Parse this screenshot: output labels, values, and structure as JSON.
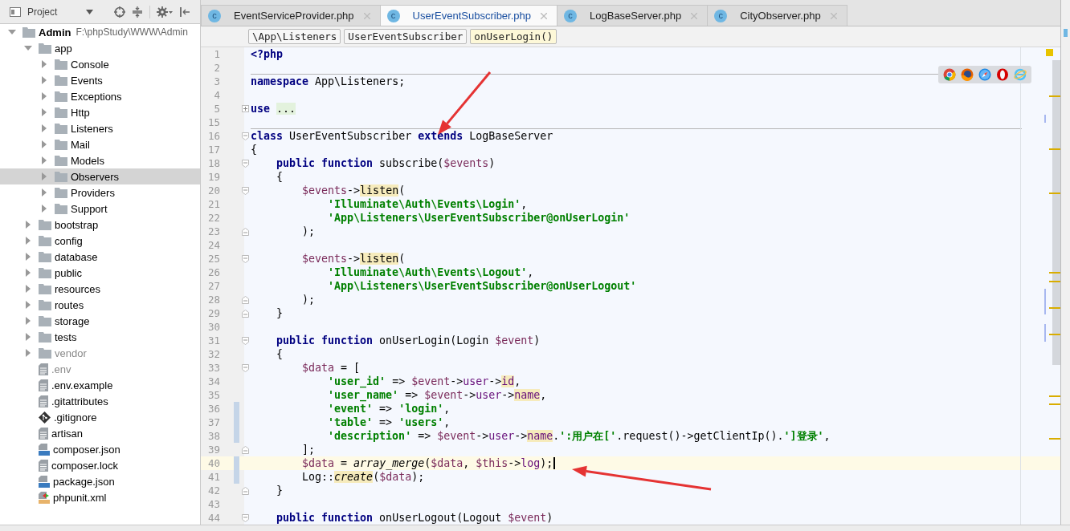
{
  "project_panel": {
    "title": "Project"
  },
  "tree": [
    {
      "name": "Admin",
      "path": "F:\\phpStudy\\WWW\\Admin",
      "kind": "folder",
      "expanded": true,
      "selected": false,
      "excluded": false,
      "children": [
        {
          "name": "app",
          "kind": "folder",
          "expanded": true,
          "selected": false,
          "excluded": false,
          "children": [
            {
              "name": "Console",
              "kind": "folder",
              "expanded": false,
              "selected": false,
              "excluded": false
            },
            {
              "name": "Events",
              "kind": "folder",
              "expanded": false,
              "selected": false,
              "excluded": false
            },
            {
              "name": "Exceptions",
              "kind": "folder",
              "expanded": false,
              "selected": false,
              "excluded": false
            },
            {
              "name": "Http",
              "kind": "folder",
              "expanded": false,
              "selected": false,
              "excluded": false
            },
            {
              "name": "Listeners",
              "kind": "folder",
              "expanded": false,
              "selected": false,
              "excluded": false
            },
            {
              "name": "Mail",
              "kind": "folder",
              "expanded": false,
              "selected": false,
              "excluded": false
            },
            {
              "name": "Models",
              "kind": "folder",
              "expanded": false,
              "selected": false,
              "excluded": false
            },
            {
              "name": "Observers",
              "kind": "folder",
              "expanded": false,
              "selected": true,
              "excluded": false
            },
            {
              "name": "Providers",
              "kind": "folder",
              "expanded": false,
              "selected": false,
              "excluded": false
            },
            {
              "name": "Support",
              "kind": "folder",
              "expanded": false,
              "selected": false,
              "excluded": false
            }
          ]
        },
        {
          "name": "bootstrap",
          "kind": "folder",
          "expanded": false,
          "selected": false,
          "excluded": false
        },
        {
          "name": "config",
          "kind": "folder",
          "expanded": false,
          "selected": false,
          "excluded": false
        },
        {
          "name": "database",
          "kind": "folder",
          "expanded": false,
          "selected": false,
          "excluded": false
        },
        {
          "name": "public",
          "kind": "folder",
          "expanded": false,
          "selected": false,
          "excluded": false
        },
        {
          "name": "resources",
          "kind": "folder",
          "expanded": false,
          "selected": false,
          "excluded": false
        },
        {
          "name": "routes",
          "kind": "folder",
          "expanded": false,
          "selected": false,
          "excluded": false
        },
        {
          "name": "storage",
          "kind": "folder",
          "expanded": false,
          "selected": false,
          "excluded": false
        },
        {
          "name": "tests",
          "kind": "folder",
          "expanded": false,
          "selected": false,
          "excluded": false
        },
        {
          "name": "vendor",
          "kind": "folder",
          "expanded": false,
          "selected": false,
          "excluded": true
        },
        {
          "name": ".env",
          "kind": "file",
          "selected": false,
          "excluded": true
        },
        {
          "name": ".env.example",
          "kind": "file",
          "selected": false,
          "excluded": false
        },
        {
          "name": ".gitattributes",
          "kind": "file",
          "selected": false,
          "excluded": false
        },
        {
          "name": ".gitignore",
          "kind": "git",
          "selected": false,
          "excluded": false
        },
        {
          "name": "artisan",
          "kind": "file",
          "selected": false,
          "excluded": false
        },
        {
          "name": "composer.json",
          "kind": "json",
          "selected": false,
          "excluded": false
        },
        {
          "name": "composer.lock",
          "kind": "file",
          "selected": false,
          "excluded": false
        },
        {
          "name": "package.json",
          "kind": "json",
          "selected": false,
          "excluded": false
        },
        {
          "name": "phpunit.xml",
          "kind": "xml",
          "selected": false,
          "excluded": false
        }
      ]
    }
  ],
  "tabs": [
    {
      "badge": "c",
      "label": "EventServiceProvider.php",
      "selected": false
    },
    {
      "badge": "c",
      "label": "UserEventSubscriber.php",
      "selected": true
    },
    {
      "badge": "c",
      "label": "LogBaseServer.php",
      "selected": false
    },
    {
      "badge": "c",
      "label": "CityObserver.php",
      "selected": false
    }
  ],
  "breadcrumbs": [
    {
      "label": "\\App\\Listeners",
      "selected": false
    },
    {
      "label": "UserEventSubscriber",
      "selected": false
    },
    {
      "label": "onUserLogin()",
      "selected": true
    }
  ],
  "code": [
    {
      "number": "1",
      "current": false,
      "changed": false,
      "separator": false,
      "tokens": [
        {
          "t": "<?php",
          "kind": "kw"
        }
      ]
    },
    {
      "number": "2",
      "current": false,
      "changed": false,
      "separator": true
    },
    {
      "number": "3",
      "current": false,
      "changed": false,
      "separator": false,
      "tokens": [
        {
          "t": "namespace",
          "kind": "kw"
        },
        {
          "t": " App\\Listeners;",
          "kind": "plain"
        }
      ]
    },
    {
      "number": "4",
      "current": false,
      "changed": false,
      "separator": false
    },
    {
      "number": "5",
      "fold": {
        "kind": "collapsed"
      },
      "current": false,
      "changed": false,
      "separator": false,
      "tokens": [
        {
          "t": "use ",
          "kind": "kw"
        },
        {
          "t": "...",
          "kind": "folded"
        }
      ]
    },
    {
      "number": "15",
      "current": false,
      "changed": false,
      "separator": true
    },
    {
      "number": "16",
      "fold": {
        "kind": "start"
      },
      "current": false,
      "changed": false,
      "separator": false,
      "tokens": [
        {
          "t": "class",
          "kind": "kw"
        },
        {
          "t": " UserEventSubscriber ",
          "kind": "plain"
        },
        {
          "t": "extends",
          "kind": "kw"
        },
        {
          "t": " LogBaseServer",
          "kind": "plain"
        }
      ]
    },
    {
      "number": "17",
      "current": false,
      "changed": false,
      "separator": false,
      "tokens": [
        {
          "t": "{",
          "kind": "plain"
        }
      ]
    },
    {
      "number": "18",
      "fold": {
        "kind": "start"
      },
      "current": false,
      "changed": false,
      "separator": false,
      "tokens": [
        {
          "t": "    public function",
          "kind": "kw"
        },
        {
          "t": " subscribe(",
          "kind": "plain"
        },
        {
          "t": "$events",
          "kind": "var"
        },
        {
          "t": ")",
          "kind": "plain"
        }
      ]
    },
    {
      "number": "19",
      "current": false,
      "changed": false,
      "separator": false,
      "tokens": [
        {
          "t": "    {",
          "kind": "plain"
        }
      ]
    },
    {
      "number": "20",
      "fold": {
        "kind": "start"
      },
      "current": false,
      "changed": false,
      "separator": false,
      "tokens": [
        {
          "t": "        $events",
          "kind": "var"
        },
        {
          "t": "->",
          "kind": "plain"
        },
        {
          "t": "listen",
          "kind": "warn"
        },
        {
          "t": "(",
          "kind": "plain"
        }
      ]
    },
    {
      "number": "21",
      "current": false,
      "changed": false,
      "separator": false,
      "tokens": [
        {
          "t": "            'Illuminate\\Auth\\Events\\Login'",
          "kind": "str"
        },
        {
          "t": ",",
          "kind": "plain"
        }
      ]
    },
    {
      "number": "22",
      "current": false,
      "changed": false,
      "separator": false,
      "tokens": [
        {
          "t": "            'App\\Listeners\\UserEventSubscriber@onUserLogin'",
          "kind": "str"
        }
      ]
    },
    {
      "number": "23",
      "fold": {
        "kind": "end"
      },
      "current": false,
      "changed": false,
      "separator": false,
      "tokens": [
        {
          "t": "        );",
          "kind": "plain"
        }
      ]
    },
    {
      "number": "24",
      "current": false,
      "changed": false,
      "separator": false
    },
    {
      "number": "25",
      "fold": {
        "kind": "start"
      },
      "current": false,
      "changed": false,
      "separator": false,
      "tokens": [
        {
          "t": "        $events",
          "kind": "var"
        },
        {
          "t": "->",
          "kind": "plain"
        },
        {
          "t": "listen",
          "kind": "warn"
        },
        {
          "t": "(",
          "kind": "plain"
        }
      ]
    },
    {
      "number": "26",
      "current": false,
      "changed": false,
      "separator": false,
      "tokens": [
        {
          "t": "            'Illuminate\\Auth\\Events\\Logout'",
          "kind": "str"
        },
        {
          "t": ",",
          "kind": "plain"
        }
      ]
    },
    {
      "number": "27",
      "current": false,
      "changed": false,
      "separator": false,
      "tokens": [
        {
          "t": "            'App\\Listeners\\UserEventSubscriber@onUserLogout'",
          "kind": "str"
        }
      ]
    },
    {
      "number": "28",
      "fold": {
        "kind": "end"
      },
      "current": false,
      "changed": false,
      "separator": false,
      "tokens": [
        {
          "t": "        );",
          "kind": "plain"
        }
      ]
    },
    {
      "number": "29",
      "fold": {
        "kind": "end"
      },
      "current": false,
      "changed": false,
      "separator": false,
      "tokens": [
        {
          "t": "    }",
          "kind": "plain"
        }
      ]
    },
    {
      "number": "30",
      "current": false,
      "changed": false,
      "separator": false
    },
    {
      "number": "31",
      "fold": {
        "kind": "start"
      },
      "current": false,
      "changed": false,
      "separator": false,
      "tokens": [
        {
          "t": "    public function",
          "kind": "kw"
        },
        {
          "t": " onUserLogin(Login ",
          "kind": "plain"
        },
        {
          "t": "$event",
          "kind": "var"
        },
        {
          "t": ")",
          "kind": "plain"
        }
      ]
    },
    {
      "number": "32",
      "current": false,
      "changed": false,
      "separator": false,
      "tokens": [
        {
          "t": "    {",
          "kind": "plain"
        }
      ]
    },
    {
      "number": "33",
      "fold": {
        "kind": "start"
      },
      "current": false,
      "changed": false,
      "separator": false,
      "tokens": [
        {
          "t": "        $data",
          "kind": "var"
        },
        {
          "t": " = [",
          "kind": "plain"
        }
      ]
    },
    {
      "number": "34",
      "current": false,
      "changed": false,
      "separator": false,
      "tokens": [
        {
          "t": "            'user_id'",
          "kind": "str"
        },
        {
          "t": " => ",
          "kind": "plain"
        },
        {
          "t": "$event",
          "kind": "var"
        },
        {
          "t": "->",
          "kind": "plain"
        },
        {
          "t": "user",
          "kind": "field"
        },
        {
          "t": "->",
          "kind": "plain"
        },
        {
          "t": "id",
          "kind": "fieldwarn"
        },
        {
          "t": ",",
          "kind": "plain"
        }
      ]
    },
    {
      "number": "35",
      "current": false,
      "changed": false,
      "separator": false,
      "tokens": [
        {
          "t": "            'user_name'",
          "kind": "str"
        },
        {
          "t": " => ",
          "kind": "plain"
        },
        {
          "t": "$event",
          "kind": "var"
        },
        {
          "t": "->",
          "kind": "plain"
        },
        {
          "t": "user",
          "kind": "field"
        },
        {
          "t": "->",
          "kind": "plain"
        },
        {
          "t": "name",
          "kind": "fieldwarn"
        },
        {
          "t": ",",
          "kind": "plain"
        }
      ]
    },
    {
      "number": "36",
      "current": false,
      "changed": true,
      "separator": false,
      "tokens": [
        {
          "t": "            'event'",
          "kind": "str"
        },
        {
          "t": " => ",
          "kind": "plain"
        },
        {
          "t": "'login'",
          "kind": "str"
        },
        {
          "t": ",",
          "kind": "plain"
        }
      ]
    },
    {
      "number": "37",
      "current": false,
      "changed": true,
      "separator": false,
      "tokens": [
        {
          "t": "            'table'",
          "kind": "str"
        },
        {
          "t": " => ",
          "kind": "plain"
        },
        {
          "t": "'users'",
          "kind": "str"
        },
        {
          "t": ",",
          "kind": "plain"
        }
      ]
    },
    {
      "number": "38",
      "current": false,
      "changed": true,
      "separator": false,
      "tokens": [
        {
          "t": "            'description'",
          "kind": "str"
        },
        {
          "t": " => ",
          "kind": "plain"
        },
        {
          "t": "$event",
          "kind": "var"
        },
        {
          "t": "->",
          "kind": "plain"
        },
        {
          "t": "user",
          "kind": "field"
        },
        {
          "t": "->",
          "kind": "plain"
        },
        {
          "t": "name",
          "kind": "fieldwarn"
        },
        {
          "t": ".",
          "kind": "plain"
        },
        {
          "t": "':用户在['",
          "kind": "str"
        },
        {
          "t": ".request()->getClientIp().",
          "kind": "plain"
        },
        {
          "t": "']登录'",
          "kind": "str"
        },
        {
          "t": ",",
          "kind": "plain"
        }
      ]
    },
    {
      "number": "39",
      "fold": {
        "kind": "end"
      },
      "current": false,
      "changed": false,
      "separator": false,
      "tokens": [
        {
          "t": "        ];",
          "kind": "plain"
        }
      ]
    },
    {
      "number": "40",
      "current": true,
      "changed": true,
      "separator": false,
      "tokens": [
        {
          "t": "        $data",
          "kind": "var"
        },
        {
          "t": " = ",
          "kind": "plain"
        },
        {
          "t": "array_merge",
          "kind": "fn"
        },
        {
          "t": "(",
          "kind": "plain"
        },
        {
          "t": "$data",
          "kind": "var"
        },
        {
          "t": ", ",
          "kind": "plain"
        },
        {
          "t": "$this",
          "kind": "var"
        },
        {
          "t": "->",
          "kind": "plain"
        },
        {
          "t": "log",
          "kind": "field"
        },
        {
          "t": ");",
          "kind": "plain"
        }
      ]
    },
    {
      "number": "41",
      "current": false,
      "changed": true,
      "separator": false,
      "tokens": [
        {
          "t": "        Log::",
          "kind": "plain"
        },
        {
          "t": "create",
          "kind": "fnwarn"
        },
        {
          "t": "(",
          "kind": "plain"
        },
        {
          "t": "$data",
          "kind": "var"
        },
        {
          "t": ");",
          "kind": "plain"
        }
      ]
    },
    {
      "number": "42",
      "fold": {
        "kind": "end"
      },
      "current": false,
      "changed": false,
      "separator": false,
      "tokens": [
        {
          "t": "    }",
          "kind": "plain"
        }
      ]
    },
    {
      "number": "43",
      "current": false,
      "changed": false,
      "separator": false
    },
    {
      "number": "44",
      "fold": {
        "kind": "start"
      },
      "current": false,
      "changed": false,
      "separator": false,
      "tokens": [
        {
          "t": "    public function",
          "kind": "kw"
        },
        {
          "t": " onUserLogout(Logout ",
          "kind": "plain"
        },
        {
          "t": "$event",
          "kind": "var"
        },
        {
          "t": ")",
          "kind": "plain"
        }
      ]
    }
  ]
}
